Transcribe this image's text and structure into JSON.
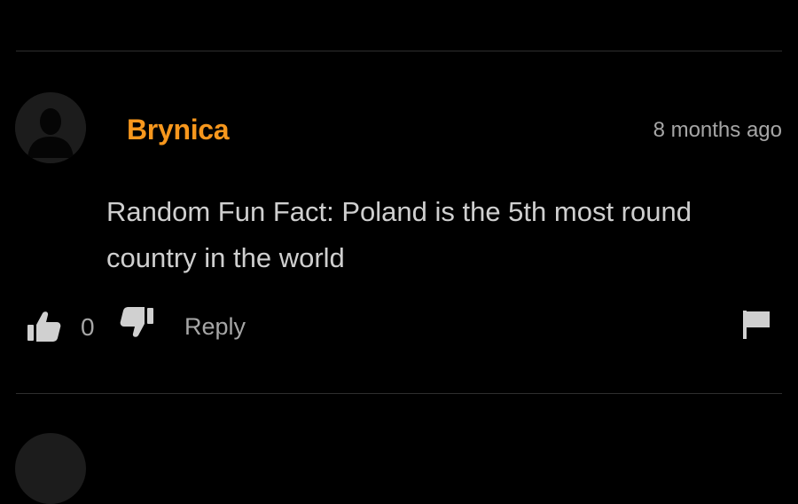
{
  "comment": {
    "username": "Brynica",
    "timestamp": "8 months ago",
    "text": "Random Fun Fact: Poland is the 5th most round country in the world",
    "votes": "0",
    "reply_label": "Reply"
  },
  "icons": {
    "avatar": "default-user-avatar-icon",
    "thumb_up": "thumbs-up-icon",
    "thumb_down": "thumbs-down-icon",
    "flag": "flag-icon"
  },
  "colors": {
    "background": "#000000",
    "username": "#f7971d",
    "text": "#cfcfcf",
    "muted": "#a6a6a6",
    "divider": "#2e2e2e",
    "icon": "#d0d0d0"
  }
}
